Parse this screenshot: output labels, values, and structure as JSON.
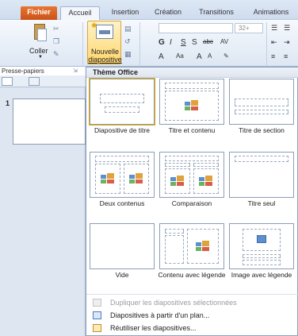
{
  "ribbon": {
    "tabs": [
      "Fichier",
      "Accueil",
      "Insertion",
      "Création",
      "Transitions",
      "Animations"
    ],
    "coller_label": "Coller",
    "new_slide_line1": "Nouvelle",
    "new_slide_line2": "diapositive",
    "font_size_value": "32+",
    "group_clipboard_label": "Presse-papiers"
  },
  "left_pane": {
    "slide_number": "1"
  },
  "gallery": {
    "header": "Thème Office",
    "layouts": [
      "Diapositive de titre",
      "Titre et contenu",
      "Titre de section",
      "Deux contenus",
      "Comparaison",
      "Titre seul",
      "Vide",
      "Contenu avec légende",
      "Image avec légende"
    ],
    "menu": [
      {
        "label": "Dupliquer les diapositives sélectionnées",
        "enabled": false,
        "icon": "duplicate-slides-icon"
      },
      {
        "label": "Diapositives à partir d'un plan...",
        "enabled": true,
        "icon": "slides-from-outline-icon"
      },
      {
        "label": "Réutiliser les diapositives...",
        "enabled": true,
        "icon": "reuse-slides-icon"
      }
    ]
  },
  "colors": {
    "file_tab": "#d2601f",
    "highlight": "#ffd66b",
    "border": "#8ea2bd"
  }
}
